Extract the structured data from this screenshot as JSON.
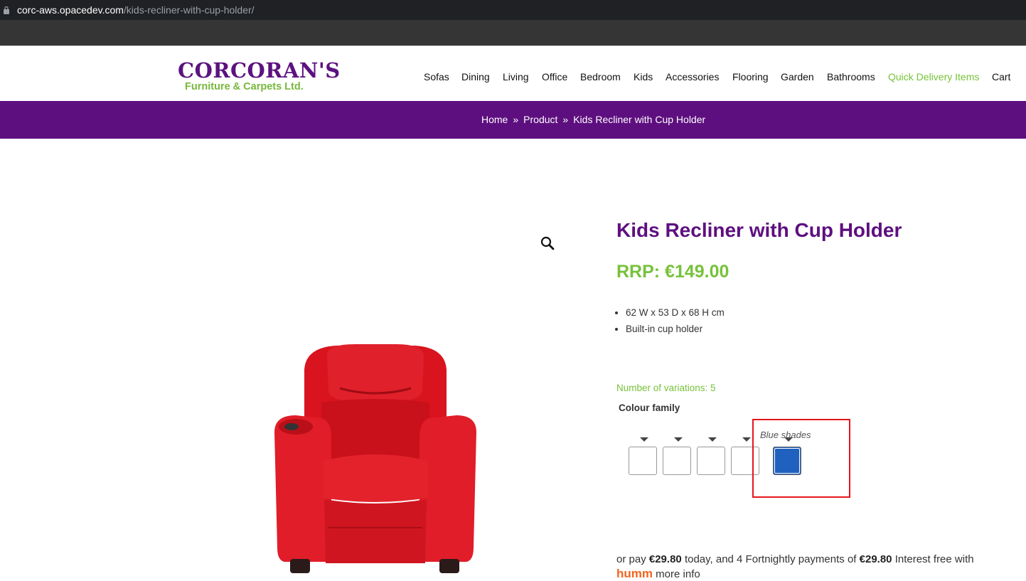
{
  "browser": {
    "url_host": "corc-aws.opacedev.com",
    "url_path": "/kids-recliner-with-cup-holder/"
  },
  "header": {
    "logo_brand": "CORCORAN'S",
    "logo_sub": "Furniture & Carpets Ltd.",
    "nav": [
      "Sofas",
      "Dining",
      "Living",
      "Office",
      "Bedroom",
      "Kids",
      "Accessories",
      "Flooring",
      "Garden",
      "Bathrooms",
      "Quick Delivery Items",
      "Cart"
    ]
  },
  "breadcrumb": {
    "items": [
      "Home",
      "Product",
      "Kids Recliner with Cup Holder"
    ],
    "separator": "»"
  },
  "product": {
    "title": "Kids Recliner with Cup Holder",
    "price": "RRP: €149.00",
    "features": [
      "62 W x 53 D x 68 H cm",
      "Built-in cup holder"
    ],
    "variations_text": "Number of variations: 5",
    "colour_family_label": "Colour family",
    "swatches": [
      {
        "color": "#ffffff"
      },
      {
        "color": "#ffffff"
      },
      {
        "color": "#ffffff"
      },
      {
        "color": "#ffffff"
      },
      {
        "color": "#2060bf",
        "label": "Blue shades",
        "selected": true
      }
    ],
    "pay": {
      "prefix": "or pay",
      "today_amount": "€29.80",
      "middle": "today, and 4 Fortnightly payments of",
      "payment_amount": "€29.80",
      "suffix": "Interest free with",
      "provider": "humm",
      "more_info": "more info"
    }
  },
  "colors": {
    "brand_purple": "#5e0f7f",
    "brand_green": "#77c23a",
    "highlight_red": "#e5141c"
  }
}
